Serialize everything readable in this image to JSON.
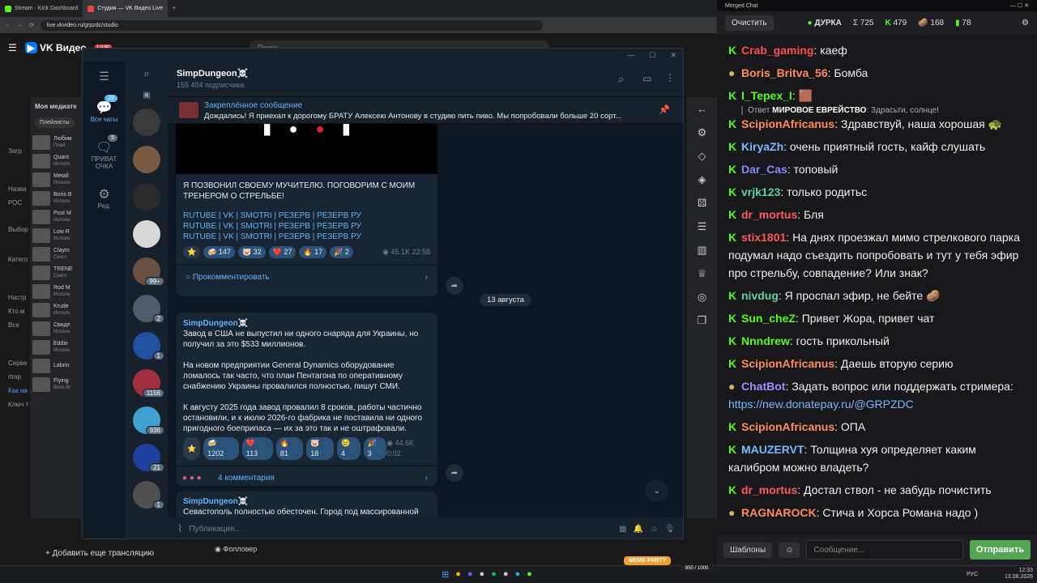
{
  "browser": {
    "tabs": [
      {
        "label": "Stream - Kick Dashboard",
        "color": "#53fc18"
      },
      {
        "label": "Студия — VK Видео Live",
        "color": "#e64646"
      }
    ],
    "url": "live.vkvideo.ru/grpzdc/studio",
    "search_placeholder": "Поиск"
  },
  "vk": {
    "logo": "VK Видео",
    "logo_badge": "LIVE",
    "add_stream": "Добавить еще трансляцию",
    "follower_label": "Фолловер",
    "sidebar_labels": [
      "Загр",
      "Назва",
      "РОС",
      "Выбор",
      "Катего",
      "Настр",
      "Кто м",
      "Все",
      "Серве",
      "rtmp",
      "Как на",
      "Ключ т"
    ],
    "media_title": "Моя медиате",
    "playlists": "Плейлисты",
    "media_items": [
      {
        "title": "Любим",
        "sub": "Плей"
      },
      {
        "title": "Quant",
        "sub": "Исполн"
      },
      {
        "title": "Metall",
        "sub": "Исполн"
      },
      {
        "title": "Boris B",
        "sub": "Исполн"
      },
      {
        "title": "Post M",
        "sub": "Исполн"
      },
      {
        "title": "Low R",
        "sub": "Исполн"
      },
      {
        "title": "Claym",
        "sub": "Сингл"
      },
      {
        "title": "TRENE",
        "sub": "Сингл"
      },
      {
        "title": "Rod M",
        "sub": "Исполн"
      },
      {
        "title": "Krude",
        "sub": "Исполн"
      },
      {
        "title": "Свиде",
        "sub": "Исполн"
      },
      {
        "title": "Eddie",
        "sub": "Исполн"
      },
      {
        "title": "Labrin",
        "sub": ""
      },
      {
        "title": "Flying",
        "sub": "Boris Br"
      }
    ]
  },
  "telegram": {
    "folders": [
      {
        "label": "Все чаты",
        "badge": "22",
        "icon": "💬"
      },
      {
        "label": "ПРИВАТ ОЧКА",
        "badge": "5",
        "icon": "🗨"
      },
      {
        "label": "Ред.",
        "badge": "",
        "icon": "⚙"
      }
    ],
    "chat_badges": [
      "",
      "",
      "",
      "",
      "99+",
      "2",
      "1",
      "1156",
      "936",
      "21",
      "1"
    ],
    "channel_name": "SimpDungeon☠️",
    "subscribers": "155 404 подписчика",
    "pinned_label": "Закреплённое сообщение",
    "pinned_text": "Дождались!  Я приехал к дорогому БРАТУ Алексею Антонову в студию пить пиво. Мы попробовали больше 20 сорт...",
    "msg1": {
      "text": "Я ПОЗВОНИЛ СВОЕМУ МУЧИТЕЛЮ. ПОГОВОРИМ С МОИМ ТРЕНЕРОМ О СТРЕЛЬБЕ!",
      "links": [
        "RUTUBE | VK | SMOTRI | РЕЗЕРВ | РЕЗЕРВ РУ",
        "RUTUBE | VK | SMOTRI | РЕЗЕРВ | РЕЗЕРВ РУ",
        "RUTUBE | VK | SMOTRI | РЕЗЕРВ | РЕЗЕРВ РУ"
      ],
      "reactions": [
        "⭐",
        "🍻 147",
        "🐷 32",
        "❤️ 27",
        "🔥 17",
        "🎉 2"
      ],
      "views": "45.1K",
      "time": "22:58",
      "comment": "Прокомментировать"
    },
    "date_sep": "13 августа",
    "msg2": {
      "author": "SimpDungeon☠️",
      "p1": "Завод в США не выпустил ни одного снаряда для Украины, но получил за это $533 миллионов.",
      "p2": "На новом предприятии General Dynamics оборудование ломалось так часто, что план Пентагона по оперативному снабжению Украины провалился полностью, пишут СМИ.",
      "p3": "К августу 2025 года завод провалил 8 сроков, работы частично остановили, и к июлю 2026-го фабрика не поставила ни одного пригодного боеприпаса — их за это так и не оштрафовали.",
      "reactions": [
        "⭐",
        "🍻 1202",
        "❤️ 113",
        "🔥 81",
        "🐷 18",
        "😢 4",
        "🎉 3"
      ],
      "views": "44.6K",
      "time": "0:02",
      "comments": "4 комментария"
    },
    "msg3": {
      "author": "SimpDungeon☠️",
      "text": "Севастополь полностью обесточен. Город под массированной"
    },
    "input_placeholder": "Публикация..."
  },
  "chat": {
    "window_title": "Merged Chat",
    "clear_button": "Очистить",
    "streamer": "ДУРКА",
    "stats": [
      "Σ 725",
      "479",
      "168",
      "78"
    ],
    "messages": [
      {
        "user": "Crab_gaming",
        "color": "#ff4d4d",
        "text": "каеф",
        "platform": "kick"
      },
      {
        "user": "Boris_Britva_56",
        "color": "#ff8c5a",
        "text": "Бомба",
        "platform": "other"
      },
      {
        "user": "I_Tepex_I",
        "color": "#53fc18",
        "text": "🟫",
        "platform": "kick"
      },
      {
        "user": "ScipionAfricanus",
        "color": "#ff8c5a",
        "text": "Здравствуй, наша хорошая 🐢",
        "platform": "kick"
      },
      {
        "user": "KiryaZh",
        "color": "#7ab8ff",
        "text": "очень приятный гость, кайф слушать",
        "platform": "kick"
      },
      {
        "user": "Dar_Cas",
        "color": "#7a8cff",
        "text": "топовый",
        "platform": "kick"
      },
      {
        "user": "vrjk123",
        "color": "#5ed0a0",
        "text": "только родитьс",
        "platform": "kick"
      },
      {
        "user": "dr_mortus",
        "color": "#ff5a5a",
        "text": "Бля",
        "platform": "kick"
      },
      {
        "user": "stix1801",
        "color": "#ff5a5a",
        "text": "На днях проезжал мимо стрелкового парка подумал надо съездить попробовать и тут у тебя эфир про стрельбу, совпадение? Или знак?",
        "platform": "kick"
      },
      {
        "user": "nivdug",
        "color": "#5ed0a0",
        "text": "Я проспал эфир, не бейте 🥔",
        "platform": "kick"
      },
      {
        "user": "Sun_cheZ",
        "color": "#53fc18",
        "text": "Привет Жора, привет чат",
        "platform": "kick"
      },
      {
        "user": "Nnndrew",
        "color": "#53fc18",
        "text": "гость прикольный",
        "platform": "kick"
      },
      {
        "user": "ScipionAfricanus",
        "color": "#ff8c5a",
        "text": "Даешь вторую серию",
        "platform": "kick"
      },
      {
        "user": "ChatBot",
        "color": "#a58cff",
        "text": "Задать вопрос или поддержать стримера: ",
        "link": "https://new.donatepay.ru/@GRPZDC",
        "platform": "other"
      },
      {
        "user": "ScipionAfricanus",
        "color": "#ff8c5a",
        "text": "ОПА",
        "platform": "kick"
      },
      {
        "user": "MAUZERVT",
        "color": "#7ab8ff",
        "text": "Толщина хуя определяет каким калибром можно владеть?",
        "platform": "kick"
      },
      {
        "user": "dr_mortus",
        "color": "#ff5a5a",
        "text": "Достал ствол - не забудь почистить",
        "platform": "kick"
      },
      {
        "user": "RAGNAROCK",
        "color": "#ff8c5a",
        "text": "Стича и Хорса Романа надо )",
        "platform": "other"
      }
    ],
    "reply": {
      "prefix": "Ответ",
      "user": "МИРОВОЕ ЕВРЕЙСТВО",
      "text": "Здрасьти, солнце!"
    },
    "templates_button": "Шаблоны",
    "input_placeholder": "Сообщение...",
    "send_button": "Отправить"
  },
  "taskbar": {
    "lang": "РУС",
    "time": "12:33",
    "date": "13.08.2026",
    "meme": "MEME PARTY",
    "meme_counter": "850 / 1000"
  }
}
